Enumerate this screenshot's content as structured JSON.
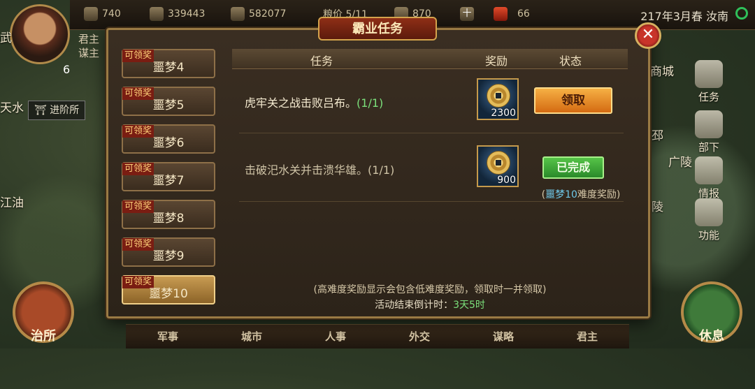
{
  "topbar": {
    "resources": [
      {
        "icon": "troops-icon",
        "value": "740"
      },
      {
        "icon": "gold-icon",
        "value": "339443"
      },
      {
        "icon": "food-icon",
        "value": "582077"
      }
    ],
    "grain_price": "粮价 5/11",
    "res4": {
      "icon": "jade-icon",
      "value": "870"
    },
    "plus_label": "十",
    "res5": {
      "icon": "token-icon",
      "value": "66"
    },
    "date_location": "217年3月春 汝南"
  },
  "player": {
    "level": "6",
    "lord_label": "君主",
    "advisor_label": "谋主"
  },
  "map": {
    "left_labels": [
      "武",
      "天水",
      "江油"
    ],
    "advance_label": "进阶所",
    "right_labels": [
      "商城",
      "邳",
      "广陵",
      "陵"
    ]
  },
  "right_nav": [
    {
      "icon": "task-icon",
      "label": "任务"
    },
    {
      "icon": "subordinate-icon",
      "label": "部下"
    },
    {
      "icon": "intel-icon",
      "label": "情报"
    },
    {
      "icon": "function-icon",
      "label": "功能"
    }
  ],
  "big_buttons": {
    "left": "治所",
    "right": "休息"
  },
  "bottom_nav": [
    "军事",
    "城市",
    "人事",
    "外交",
    "谋略",
    "君主"
  ],
  "dialog": {
    "title": "霸业任务",
    "close": "✕",
    "tabs": [
      {
        "badge": "可领奖",
        "label": "噩梦4",
        "active": false
      },
      {
        "badge": "可领奖",
        "label": "噩梦5",
        "active": false
      },
      {
        "badge": "可领奖",
        "label": "噩梦6",
        "active": false
      },
      {
        "badge": "可领奖",
        "label": "噩梦7",
        "active": false
      },
      {
        "badge": "可领奖",
        "label": "噩梦8",
        "active": false
      },
      {
        "badge": "可领奖",
        "label": "噩梦9",
        "active": false
      },
      {
        "badge": "可领奖",
        "label": "噩梦10",
        "active": true
      }
    ],
    "headers": {
      "task": "任务",
      "reward": "奖励",
      "status": "状态"
    },
    "tasks": [
      {
        "text": "虎牢关之战击败吕布。",
        "progress": "(1/1)",
        "reward": "2300",
        "status": "领取"
      },
      {
        "text": "击破汜水关并击溃华雄。",
        "progress": "(1/1)",
        "reward": "900",
        "status": "已完成",
        "note_hl": "噩梦10",
        "note_rest": "难度奖励)",
        "note_open": "("
      }
    ],
    "footer_note": "(高难度奖励显示会包含低难度奖励，领取时一并领取)",
    "countdown_label": "活动结束倒计时：",
    "countdown_value": "3天5时"
  },
  "colors": {
    "claim": "#e07a1a",
    "done": "#3aa83a",
    "highlight_green": "#7be07b",
    "highlight_blue": "#6fc8e8"
  }
}
